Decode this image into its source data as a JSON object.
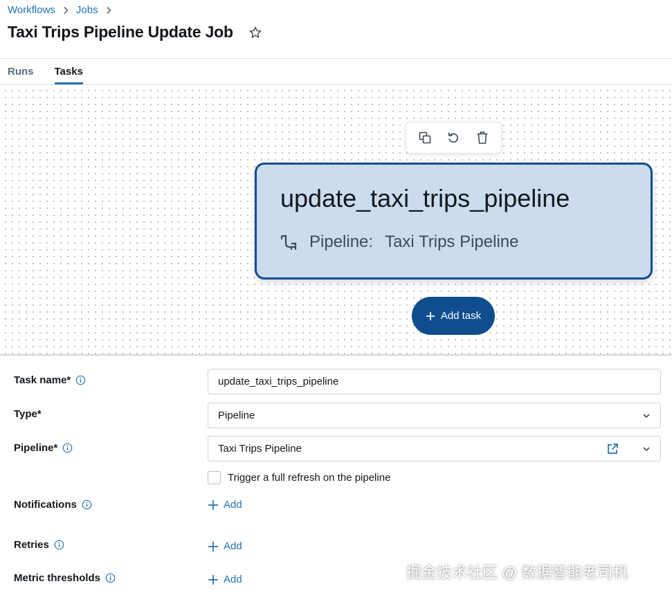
{
  "breadcrumb": {
    "items": [
      "Workflows",
      "Jobs"
    ]
  },
  "page": {
    "title": "Taxi Trips Pipeline Update Job"
  },
  "tabs": [
    {
      "label": "Runs",
      "active": false
    },
    {
      "label": "Tasks",
      "active": true
    }
  ],
  "node": {
    "toolbar_icons": [
      "copy-icon",
      "undo-icon",
      "trash-icon"
    ],
    "title": "update_taxi_trips_pipeline",
    "type_label": "Pipeline:",
    "type_value": "Taxi Trips Pipeline"
  },
  "add_task": {
    "label": "Add task"
  },
  "form": {
    "task_name": {
      "label": "Task name*",
      "value": "update_taxi_trips_pipeline"
    },
    "type": {
      "label": "Type*",
      "value": "Pipeline"
    },
    "pipeline": {
      "label": "Pipeline*",
      "value": "Taxi Trips Pipeline"
    },
    "full_refresh": {
      "label": "Trigger a full refresh on the pipeline",
      "checked": false
    },
    "notifications": {
      "label": "Notifications",
      "add_label": "Add"
    },
    "retries": {
      "label": "Retries",
      "add_label": "Add"
    },
    "metric_thresholds": {
      "label": "Metric thresholds",
      "add_label": "Add"
    }
  },
  "watermark": "掘金技术社区 @ 数据智能老司机",
  "colors": {
    "accent": "#2272b4",
    "node_fill": "#cadcee",
    "node_border": "#0e4d8e",
    "button": "#0e4d8e"
  }
}
